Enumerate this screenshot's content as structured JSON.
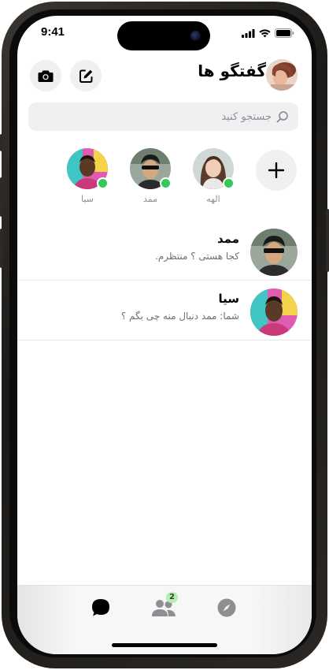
{
  "status_bar": {
    "time": "9:41"
  },
  "header": {
    "title": "گفتگو ها",
    "camera_icon": "camera-icon",
    "compose_icon": "compose-icon"
  },
  "search": {
    "placeholder": "جستجو کنید",
    "icon": "search-icon"
  },
  "stories": {
    "add_icon": "plus-icon",
    "items": [
      {
        "name": "الهه",
        "online": true
      },
      {
        "name": "ممد",
        "online": true
      },
      {
        "name": "سیا",
        "online": true
      }
    ]
  },
  "chats": [
    {
      "name": "ممد",
      "preview": "کجا هستی ؟ منتظرم."
    },
    {
      "name": "سیا",
      "preview": "شما: ممد دنبال منه چی بگم ؟"
    }
  ],
  "tabbar": {
    "chats_icon": "chat-bubble-icon",
    "people_icon": "people-icon",
    "people_badge": "2",
    "discover_icon": "compass-icon"
  },
  "colors": {
    "online": "#34c759",
    "badge_bg": "#b5f0b0"
  }
}
